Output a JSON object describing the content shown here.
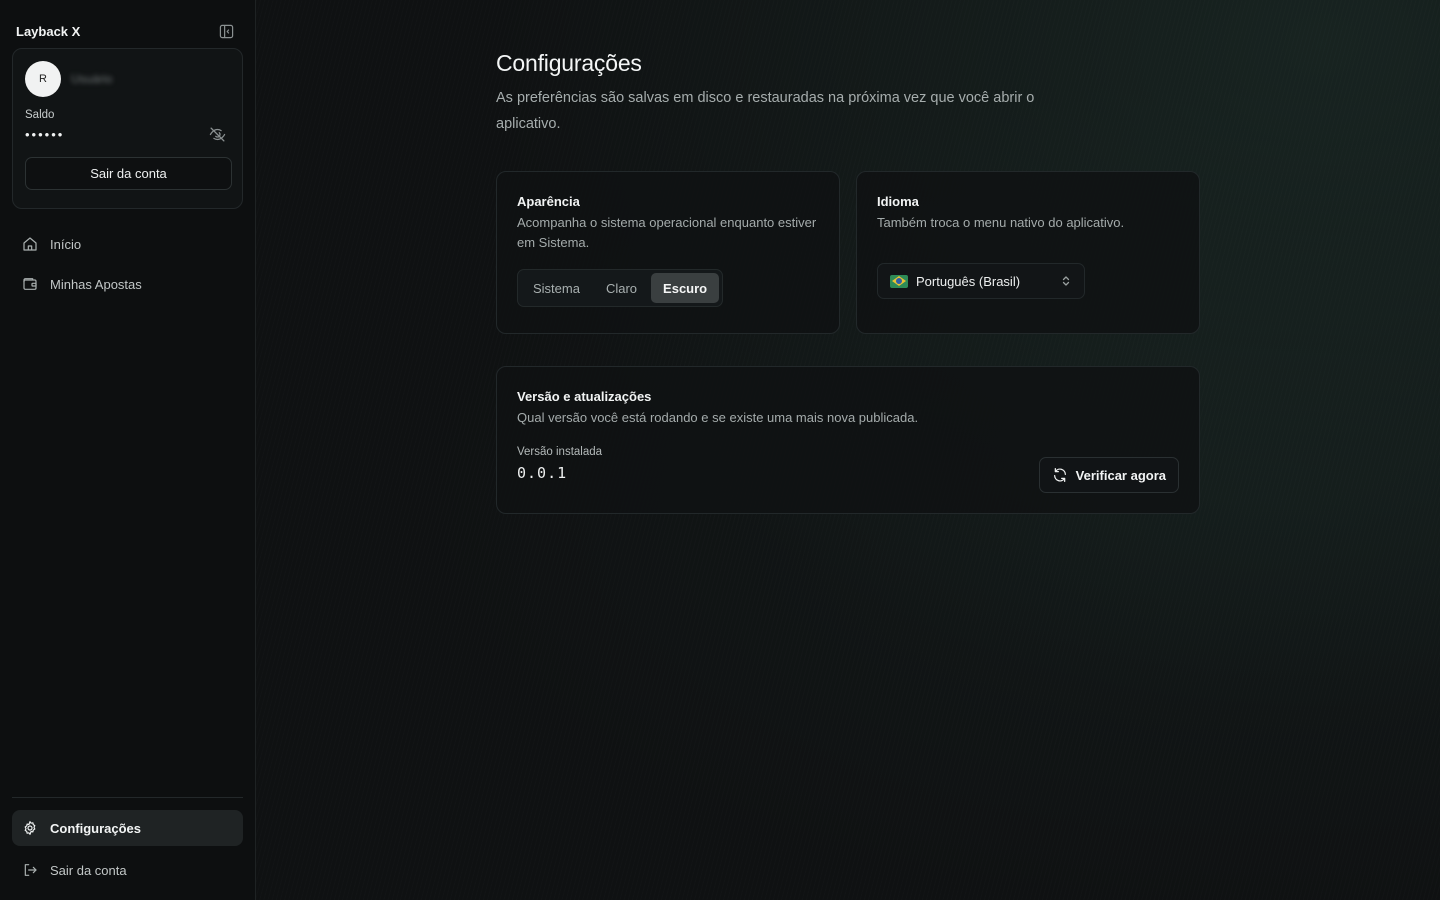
{
  "app": {
    "title": "Layback X"
  },
  "account": {
    "avatar_initial": "R",
    "username": "Usuário",
    "balance_label": "Saldo",
    "balance_masked": "••••••",
    "logout_label": "Sair da conta"
  },
  "nav": {
    "items": [
      {
        "label": "Início",
        "icon": "home-icon"
      },
      {
        "label": "Minhas Apostas",
        "icon": "wallet-icon"
      }
    ],
    "bottom": [
      {
        "label": "Configurações",
        "icon": "gear-icon",
        "active": true
      },
      {
        "label": "Sair da conta",
        "icon": "logout-icon"
      }
    ]
  },
  "page": {
    "title": "Configurações",
    "description": "As preferências são salvas em disco e restauradas na próxima vez que você abrir o aplicativo."
  },
  "appearance": {
    "title": "Aparência",
    "description": "Acompanha o sistema operacional enquanto estiver em Sistema.",
    "options": [
      "Sistema",
      "Claro",
      "Escuro"
    ],
    "selected": "Escuro"
  },
  "language": {
    "title": "Idioma",
    "description": "Também troca o menu nativo do aplicativo.",
    "selected": "Português (Brasil)",
    "flag_icon": "brazil-flag-icon"
  },
  "version": {
    "title": "Versão e atualizações",
    "description": "Qual versão você está rodando e se existe uma mais nova publicada.",
    "installed_label": "Versão instalada",
    "installed_value": "0.0.1",
    "check_label": "Verificar agora"
  },
  "colors": {
    "background": "#0f1112",
    "sidebar": "#0d0f10",
    "card_border": "#22282a",
    "segment_active": "#3a3f40",
    "text_primary": "#f2f4f4",
    "text_muted": "#a6adad"
  }
}
